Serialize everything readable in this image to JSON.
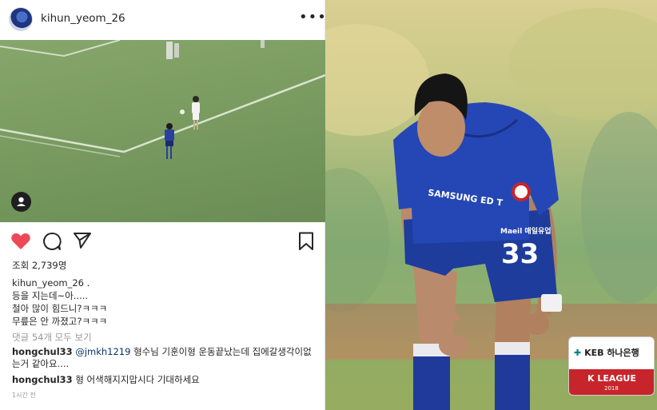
{
  "post": {
    "username": "kihun_yeom_26",
    "more_icon": "•••",
    "views": "조회 2,739명",
    "caption": {
      "username": "kihun_yeom_26 .",
      "lines": [
        "등을 지는데~아.....",
        "철아 많이 힘드니?ㅋㅋㅋ",
        "무릎은 안 까졌고?ㅋㅋㅋ"
      ]
    },
    "view_comments": "댓글 54개 모두 보기",
    "comments": [
      {
        "user": "hongchul33",
        "mention": "@jmkh1219",
        "text": "형수님 기훈이형 운동끝났는데 집에갈생각이없는거 같아요...."
      },
      {
        "user": "hongchul33",
        "mention": "",
        "text": "형 어색해지지맙시다 기대하세요"
      }
    ],
    "time_ago": "1시간 전",
    "like_color": "#ed4956"
  },
  "photo": {
    "jersey_sponsor": "SAMSUNG",
    "jersey_sponsor_2": "ED T",
    "maeil": "Maeil 매일유업",
    "number": "33",
    "badge": {
      "bank_prefix": "✚",
      "bank": "KEB 하나은행",
      "league": "K LEAGUE",
      "year": "2018"
    }
  }
}
